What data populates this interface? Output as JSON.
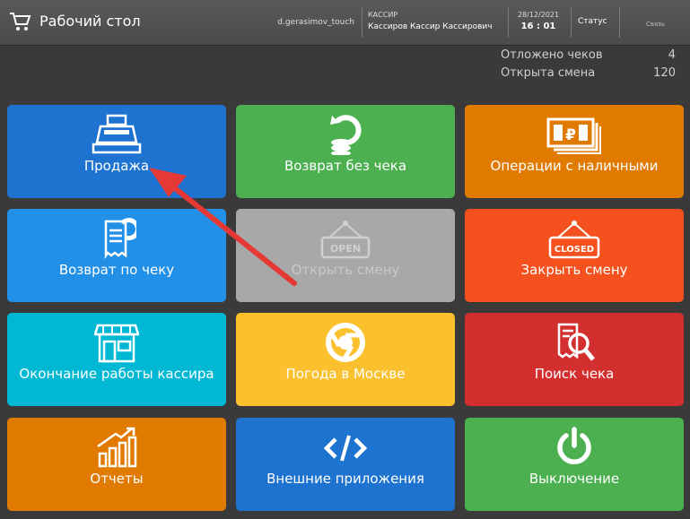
{
  "header": {
    "title": "Рабочий стол",
    "user": "d.gerasimov_touch",
    "role": "КАССИР",
    "cashier_name": "Кассиров Кассир Кассирович",
    "date": "28/12/2021",
    "time": "16 : 01",
    "status_label": "Статус",
    "connection_label": "Связь"
  },
  "stats": {
    "deferred_label": "Отложено чеков",
    "deferred_value": "4",
    "shift_label": "Открыта смена",
    "shift_value": "120"
  },
  "tiles": [
    {
      "label": "Продажа",
      "icon": "cash-register-icon",
      "color": "#1e72d0"
    },
    {
      "label": "Возврат без чека",
      "icon": "coins-return-icon",
      "color": "#4caf50"
    },
    {
      "label": "Операции с наличными",
      "icon": "banknotes-icon",
      "color": "#e07a00"
    },
    {
      "label": "Возврат по чеку",
      "icon": "receipt-return-icon",
      "color": "#2390e8"
    },
    {
      "label": "Открыть смену",
      "icon": "open-sign-icon",
      "color": "#a8a8a8"
    },
    {
      "label": "Закрыть смену",
      "icon": "closed-sign-icon",
      "color": "#f4511e"
    },
    {
      "label": "Окончание работы кассира",
      "icon": "shop-icon",
      "color": "#00b8d4"
    },
    {
      "label": "Погода в Москве",
      "icon": "chrome-icon",
      "color": "#fbc02d"
    },
    {
      "label": "Поиск чека",
      "icon": "receipt-search-icon",
      "color": "#d32f2f"
    },
    {
      "label": "Отчеты",
      "icon": "chart-icon",
      "color": "#e07a00"
    },
    {
      "label": "Внешние приложения",
      "icon": "code-icon",
      "color": "#1e72d0"
    },
    {
      "label": "Выключение",
      "icon": "power-icon",
      "color": "#4caf50"
    }
  ],
  "annotation_color": "#e53935"
}
